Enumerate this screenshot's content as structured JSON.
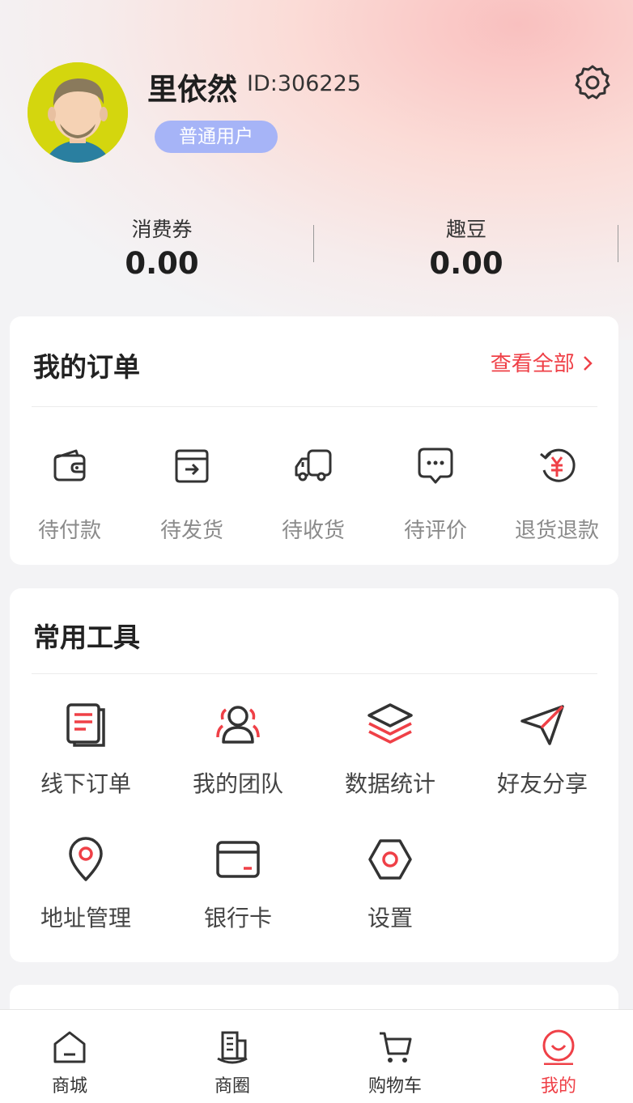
{
  "profile": {
    "name": "里依然",
    "id_text": "ID:306225",
    "role": "普通用户"
  },
  "stats": [
    {
      "label": "消费券",
      "value": "0.00"
    },
    {
      "label": "趣豆",
      "value": "0.00"
    }
  ],
  "orders": {
    "title": "我的订单",
    "view_all": "查看全部",
    "items": [
      {
        "label": "待付款",
        "icon": "wallet-icon"
      },
      {
        "label": "待发货",
        "icon": "box-icon"
      },
      {
        "label": "待收货",
        "icon": "truck-icon"
      },
      {
        "label": "待评价",
        "icon": "comment-icon"
      },
      {
        "label": "退货退款",
        "icon": "refund-icon"
      }
    ]
  },
  "tools": {
    "title": "常用工具",
    "items": [
      {
        "label": "线下订单",
        "icon": "document-icon"
      },
      {
        "label": "我的团队",
        "icon": "team-icon"
      },
      {
        "label": "数据统计",
        "icon": "layers-icon"
      },
      {
        "label": "好友分享",
        "icon": "send-icon"
      },
      {
        "label": "地址管理",
        "icon": "location-icon"
      },
      {
        "label": "银行卡",
        "icon": "card-icon"
      },
      {
        "label": "设置",
        "icon": "hexagon-settings-icon"
      }
    ]
  },
  "tabbar": [
    {
      "label": "商城",
      "icon": "home-icon",
      "active": false
    },
    {
      "label": "商圈",
      "icon": "building-icon",
      "active": false
    },
    {
      "label": "购物车",
      "icon": "cart-icon",
      "active": false
    },
    {
      "label": "我的",
      "icon": "smile-icon",
      "active": true
    }
  ],
  "colors": {
    "accent": "#ef4047",
    "badge": "#a6b4f7",
    "icon_dark": "#333333"
  }
}
